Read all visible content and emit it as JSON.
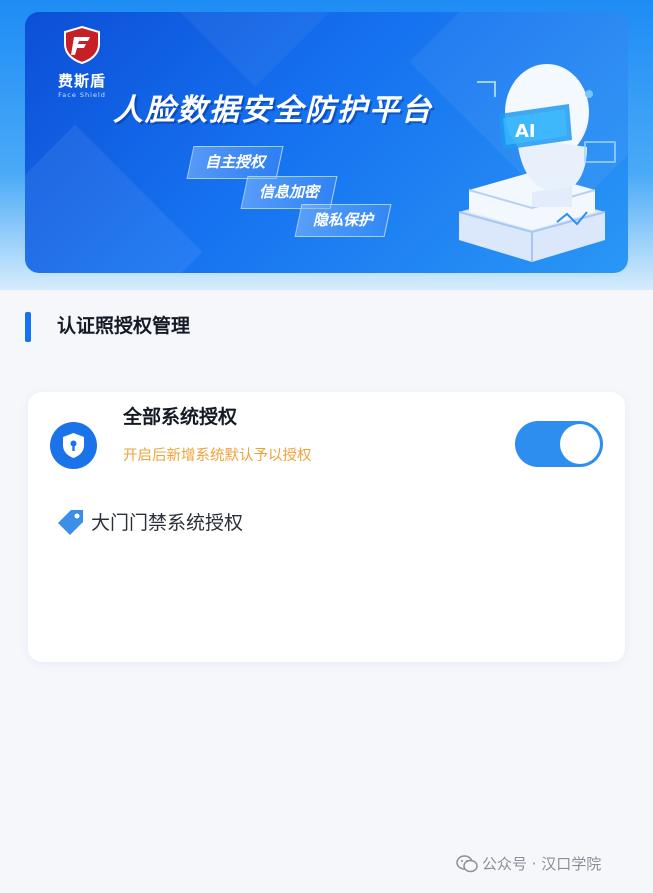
{
  "banner": {
    "logo_cn": "费斯盾",
    "logo_en": "Face Shield",
    "title": "人脸数据安全防护平台",
    "tags": [
      "自主授权",
      "信息加密",
      "隐私保护"
    ]
  },
  "section": {
    "title": "认证照授权管理"
  },
  "card": {
    "title": "全部系统授权",
    "subtitle": "开启后新增系统默认予以授权",
    "toggle_on": true,
    "system_label": "大门门禁系统授权"
  },
  "footer": {
    "text": "公众号 · 汉口学院"
  },
  "colors": {
    "accent": "#1673f0",
    "toggle": "#2d8ef0",
    "warning_text": "#f0a23a",
    "background": "#f5f7fb"
  },
  "icons": [
    "shield-logo-icon",
    "shield-lock-icon",
    "tag-icon",
    "wechat-icon"
  ]
}
